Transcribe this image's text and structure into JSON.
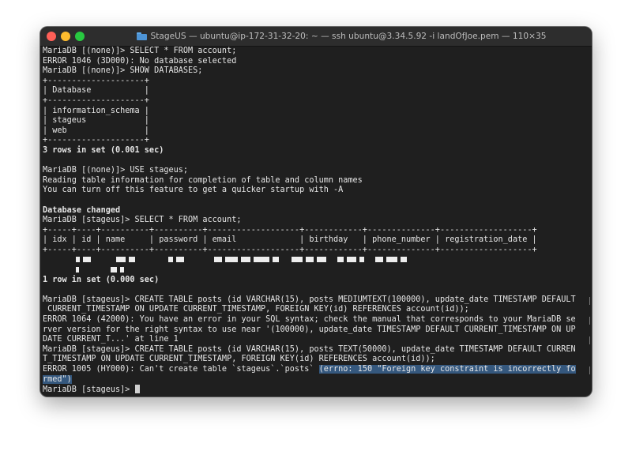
{
  "window": {
    "title": "StageUS — ubuntu@ip-172-31-32-20: ~ — ssh ubuntu@3.34.5.92 -i landOfJoe.pem — 110×35",
    "folder_icon": "folder-icon"
  },
  "terminal": {
    "lines": [
      "MariaDB [(none)]> SELECT * FROM account;",
      "ERROR 1046 (3D000): No database selected",
      "MariaDB [(none)]> SHOW DATABASES;",
      "+--------------------+",
      "| Database           |",
      "+--------------------+",
      "| information_schema |",
      "| stageus            |",
      "| web                |",
      "+--------------------+",
      "3 rows in set (0.001 sec)",
      "",
      "MariaDB [(none)]> USE stageus;",
      "Reading table information for completion of table and column names",
      "You can turn off this feature to get a quicker startup with -A",
      "",
      "Database changed",
      "MariaDB [stageus]> SELECT * FROM account;",
      "+-----+----+----------+----------+-------------------+------------+--------------+-------------------+",
      "| idx | id | name     | password | email             | birthday   | phone_number | registration_date |",
      "+-----+----+----------+----------+-------------------+------------+--------------+-------------------+",
      "",
      "",
      "1 row in set (0.000 sec)",
      "",
      "MariaDB [stageus]> CREATE TABLE posts (id VARCHAR(15), posts MEDIUMTEXT(100000), update_date TIMESTAMP DEFAULT",
      " CURRENT_TIMESTAMP ON UPDATE CURRENT_TIMESTAMP, FOREIGN KEY(id) REFERENCES account(id));",
      "ERROR 1064 (42000): You have an error in your SQL syntax; check the manual that corresponds to your MariaDB se",
      "rver version for the right syntax to use near '(100000), update_date TIMESTAMP DEFAULT CURRENT_TIMESTAMP ON UP",
      "DATE CURRENT_T...' at line 1",
      "MariaDB [stageus]> CREATE TABLE posts (id VARCHAR(15), posts TEXT(50000), update_date TIMESTAMP DEFAULT CURREN",
      "T_TIMESTAMP ON UPDATE CURRENT_TIMESTAMP, FOREIGN KEY(id) REFERENCES account(id));",
      "ERROR 1005 (HY000): Can't create table `stageus`.`posts` ",
      "rmed\")",
      "MariaDB [stageus]> "
    ],
    "highlighted_fragment": "(errno: 150 \"Foreign key constraint is incorrectly fo"
  }
}
